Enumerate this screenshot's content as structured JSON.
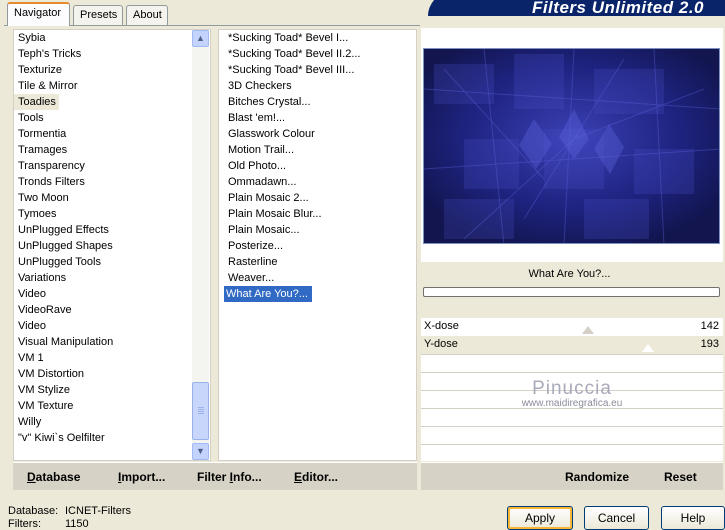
{
  "tabs": [
    "Navigator",
    "Presets",
    "About"
  ],
  "banner": "Filters Unlimited 2.0",
  "categories": [
    "Sybia",
    "Teph's Tricks",
    "Texturize",
    "Tile & Mirror",
    "Toadies",
    "Tools",
    "Tormentia",
    "Tramages",
    "Transparency",
    "Tronds Filters",
    "Two Moon",
    "Tymoes",
    "UnPlugged Effects",
    "UnPlugged Shapes",
    "UnPlugged Tools",
    "Variations",
    "Video",
    "VideoRave",
    "Video",
    "Visual Manipulation",
    "VM 1",
    "VM Distortion",
    "VM Stylize",
    "VM Texture",
    "Willy",
    "\"v\" Kiwi`s Oelfilter"
  ],
  "categories_highlighted": "Toadies",
  "filters": [
    "*Sucking Toad*  Bevel I...",
    "*Sucking Toad*  Bevel II.2...",
    "*Sucking Toad*  Bevel III...",
    "3D Checkers",
    "Bitches Crystal...",
    "Blast 'em!...",
    "Glasswork Colour",
    "Motion Trail...",
    "Old Photo...",
    "Ommadawn...",
    "Plain Mosaic 2...",
    "Plain Mosaic Blur...",
    "Plain Mosaic...",
    "Posterize...",
    "Rasterline",
    "Weaver...",
    "What Are You?..."
  ],
  "filters_selected": "What Are You?...",
  "filter_title": "What Are You?...",
  "params": [
    {
      "label": "X-dose",
      "value": "142",
      "fraction": 0.557
    },
    {
      "label": "Y-dose",
      "value": "193",
      "fraction": 0.757
    }
  ],
  "watermark": {
    "line1": "Pinuccia",
    "line2": "www.maidiregrafica.eu"
  },
  "left_buttons": [
    {
      "prefix": "",
      "accel": "D",
      "rest": "atabase"
    },
    {
      "prefix": "",
      "accel": "I",
      "rest": "mport..."
    },
    {
      "prefix": "Filter ",
      "accel": "I",
      "rest": "nfo..."
    },
    {
      "prefix": "",
      "accel": "E",
      "rest": "ditor..."
    }
  ],
  "right_buttons": [
    "Randomize",
    "Reset"
  ],
  "status": {
    "database_label": "Database:",
    "database_value": "ICNET-Filters",
    "filters_label": "Filters:",
    "filters_value": "1150"
  },
  "dialog_buttons": [
    "Apply",
    "Cancel",
    "Help"
  ],
  "colors": {
    "selection": "#316ac5",
    "banner": "#0a246a",
    "preview_base": "#1a1f6e"
  },
  "icons": {
    "scroll_up": "chevron-up-icon",
    "scroll_down": "chevron-down-icon"
  }
}
